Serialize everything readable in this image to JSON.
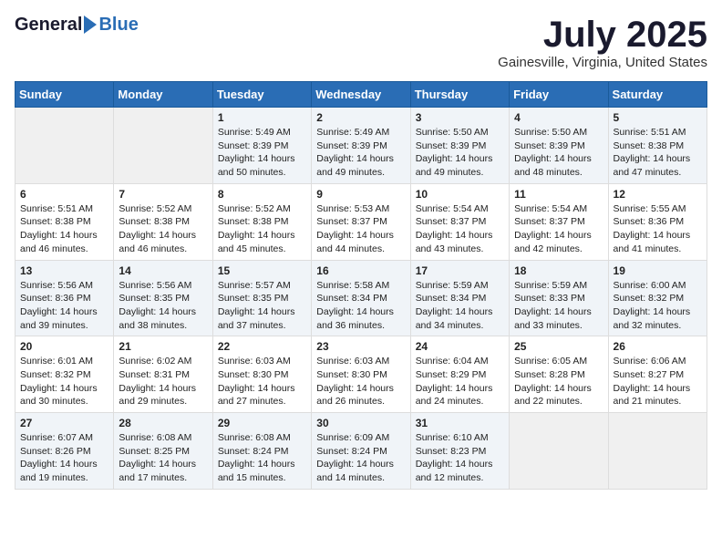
{
  "header": {
    "logo_general": "General",
    "logo_blue": "Blue",
    "month_title": "July 2025",
    "location": "Gainesville, Virginia, United States"
  },
  "days_of_week": [
    "Sunday",
    "Monday",
    "Tuesday",
    "Wednesday",
    "Thursday",
    "Friday",
    "Saturday"
  ],
  "weeks": [
    [
      {
        "day": "",
        "sunrise": "",
        "sunset": "",
        "daylight": "",
        "empty": true
      },
      {
        "day": "",
        "sunrise": "",
        "sunset": "",
        "daylight": "",
        "empty": true
      },
      {
        "day": "1",
        "sunrise": "Sunrise: 5:49 AM",
        "sunset": "Sunset: 8:39 PM",
        "daylight": "Daylight: 14 hours and 50 minutes."
      },
      {
        "day": "2",
        "sunrise": "Sunrise: 5:49 AM",
        "sunset": "Sunset: 8:39 PM",
        "daylight": "Daylight: 14 hours and 49 minutes."
      },
      {
        "day": "3",
        "sunrise": "Sunrise: 5:50 AM",
        "sunset": "Sunset: 8:39 PM",
        "daylight": "Daylight: 14 hours and 49 minutes."
      },
      {
        "day": "4",
        "sunrise": "Sunrise: 5:50 AM",
        "sunset": "Sunset: 8:39 PM",
        "daylight": "Daylight: 14 hours and 48 minutes."
      },
      {
        "day": "5",
        "sunrise": "Sunrise: 5:51 AM",
        "sunset": "Sunset: 8:38 PM",
        "daylight": "Daylight: 14 hours and 47 minutes."
      }
    ],
    [
      {
        "day": "6",
        "sunrise": "Sunrise: 5:51 AM",
        "sunset": "Sunset: 8:38 PM",
        "daylight": "Daylight: 14 hours and 46 minutes."
      },
      {
        "day": "7",
        "sunrise": "Sunrise: 5:52 AM",
        "sunset": "Sunset: 8:38 PM",
        "daylight": "Daylight: 14 hours and 46 minutes."
      },
      {
        "day": "8",
        "sunrise": "Sunrise: 5:52 AM",
        "sunset": "Sunset: 8:38 PM",
        "daylight": "Daylight: 14 hours and 45 minutes."
      },
      {
        "day": "9",
        "sunrise": "Sunrise: 5:53 AM",
        "sunset": "Sunset: 8:37 PM",
        "daylight": "Daylight: 14 hours and 44 minutes."
      },
      {
        "day": "10",
        "sunrise": "Sunrise: 5:54 AM",
        "sunset": "Sunset: 8:37 PM",
        "daylight": "Daylight: 14 hours and 43 minutes."
      },
      {
        "day": "11",
        "sunrise": "Sunrise: 5:54 AM",
        "sunset": "Sunset: 8:37 PM",
        "daylight": "Daylight: 14 hours and 42 minutes."
      },
      {
        "day": "12",
        "sunrise": "Sunrise: 5:55 AM",
        "sunset": "Sunset: 8:36 PM",
        "daylight": "Daylight: 14 hours and 41 minutes."
      }
    ],
    [
      {
        "day": "13",
        "sunrise": "Sunrise: 5:56 AM",
        "sunset": "Sunset: 8:36 PM",
        "daylight": "Daylight: 14 hours and 39 minutes."
      },
      {
        "day": "14",
        "sunrise": "Sunrise: 5:56 AM",
        "sunset": "Sunset: 8:35 PM",
        "daylight": "Daylight: 14 hours and 38 minutes."
      },
      {
        "day": "15",
        "sunrise": "Sunrise: 5:57 AM",
        "sunset": "Sunset: 8:35 PM",
        "daylight": "Daylight: 14 hours and 37 minutes."
      },
      {
        "day": "16",
        "sunrise": "Sunrise: 5:58 AM",
        "sunset": "Sunset: 8:34 PM",
        "daylight": "Daylight: 14 hours and 36 minutes."
      },
      {
        "day": "17",
        "sunrise": "Sunrise: 5:59 AM",
        "sunset": "Sunset: 8:34 PM",
        "daylight": "Daylight: 14 hours and 34 minutes."
      },
      {
        "day": "18",
        "sunrise": "Sunrise: 5:59 AM",
        "sunset": "Sunset: 8:33 PM",
        "daylight": "Daylight: 14 hours and 33 minutes."
      },
      {
        "day": "19",
        "sunrise": "Sunrise: 6:00 AM",
        "sunset": "Sunset: 8:32 PM",
        "daylight": "Daylight: 14 hours and 32 minutes."
      }
    ],
    [
      {
        "day": "20",
        "sunrise": "Sunrise: 6:01 AM",
        "sunset": "Sunset: 8:32 PM",
        "daylight": "Daylight: 14 hours and 30 minutes."
      },
      {
        "day": "21",
        "sunrise": "Sunrise: 6:02 AM",
        "sunset": "Sunset: 8:31 PM",
        "daylight": "Daylight: 14 hours and 29 minutes."
      },
      {
        "day": "22",
        "sunrise": "Sunrise: 6:03 AM",
        "sunset": "Sunset: 8:30 PM",
        "daylight": "Daylight: 14 hours and 27 minutes."
      },
      {
        "day": "23",
        "sunrise": "Sunrise: 6:03 AM",
        "sunset": "Sunset: 8:30 PM",
        "daylight": "Daylight: 14 hours and 26 minutes."
      },
      {
        "day": "24",
        "sunrise": "Sunrise: 6:04 AM",
        "sunset": "Sunset: 8:29 PM",
        "daylight": "Daylight: 14 hours and 24 minutes."
      },
      {
        "day": "25",
        "sunrise": "Sunrise: 6:05 AM",
        "sunset": "Sunset: 8:28 PM",
        "daylight": "Daylight: 14 hours and 22 minutes."
      },
      {
        "day": "26",
        "sunrise": "Sunrise: 6:06 AM",
        "sunset": "Sunset: 8:27 PM",
        "daylight": "Daylight: 14 hours and 21 minutes."
      }
    ],
    [
      {
        "day": "27",
        "sunrise": "Sunrise: 6:07 AM",
        "sunset": "Sunset: 8:26 PM",
        "daylight": "Daylight: 14 hours and 19 minutes."
      },
      {
        "day": "28",
        "sunrise": "Sunrise: 6:08 AM",
        "sunset": "Sunset: 8:25 PM",
        "daylight": "Daylight: 14 hours and 17 minutes."
      },
      {
        "day": "29",
        "sunrise": "Sunrise: 6:08 AM",
        "sunset": "Sunset: 8:24 PM",
        "daylight": "Daylight: 14 hours and 15 minutes."
      },
      {
        "day": "30",
        "sunrise": "Sunrise: 6:09 AM",
        "sunset": "Sunset: 8:24 PM",
        "daylight": "Daylight: 14 hours and 14 minutes."
      },
      {
        "day": "31",
        "sunrise": "Sunrise: 6:10 AM",
        "sunset": "Sunset: 8:23 PM",
        "daylight": "Daylight: 14 hours and 12 minutes."
      },
      {
        "day": "",
        "sunrise": "",
        "sunset": "",
        "daylight": "",
        "empty": true
      },
      {
        "day": "",
        "sunrise": "",
        "sunset": "",
        "daylight": "",
        "empty": true
      }
    ]
  ]
}
